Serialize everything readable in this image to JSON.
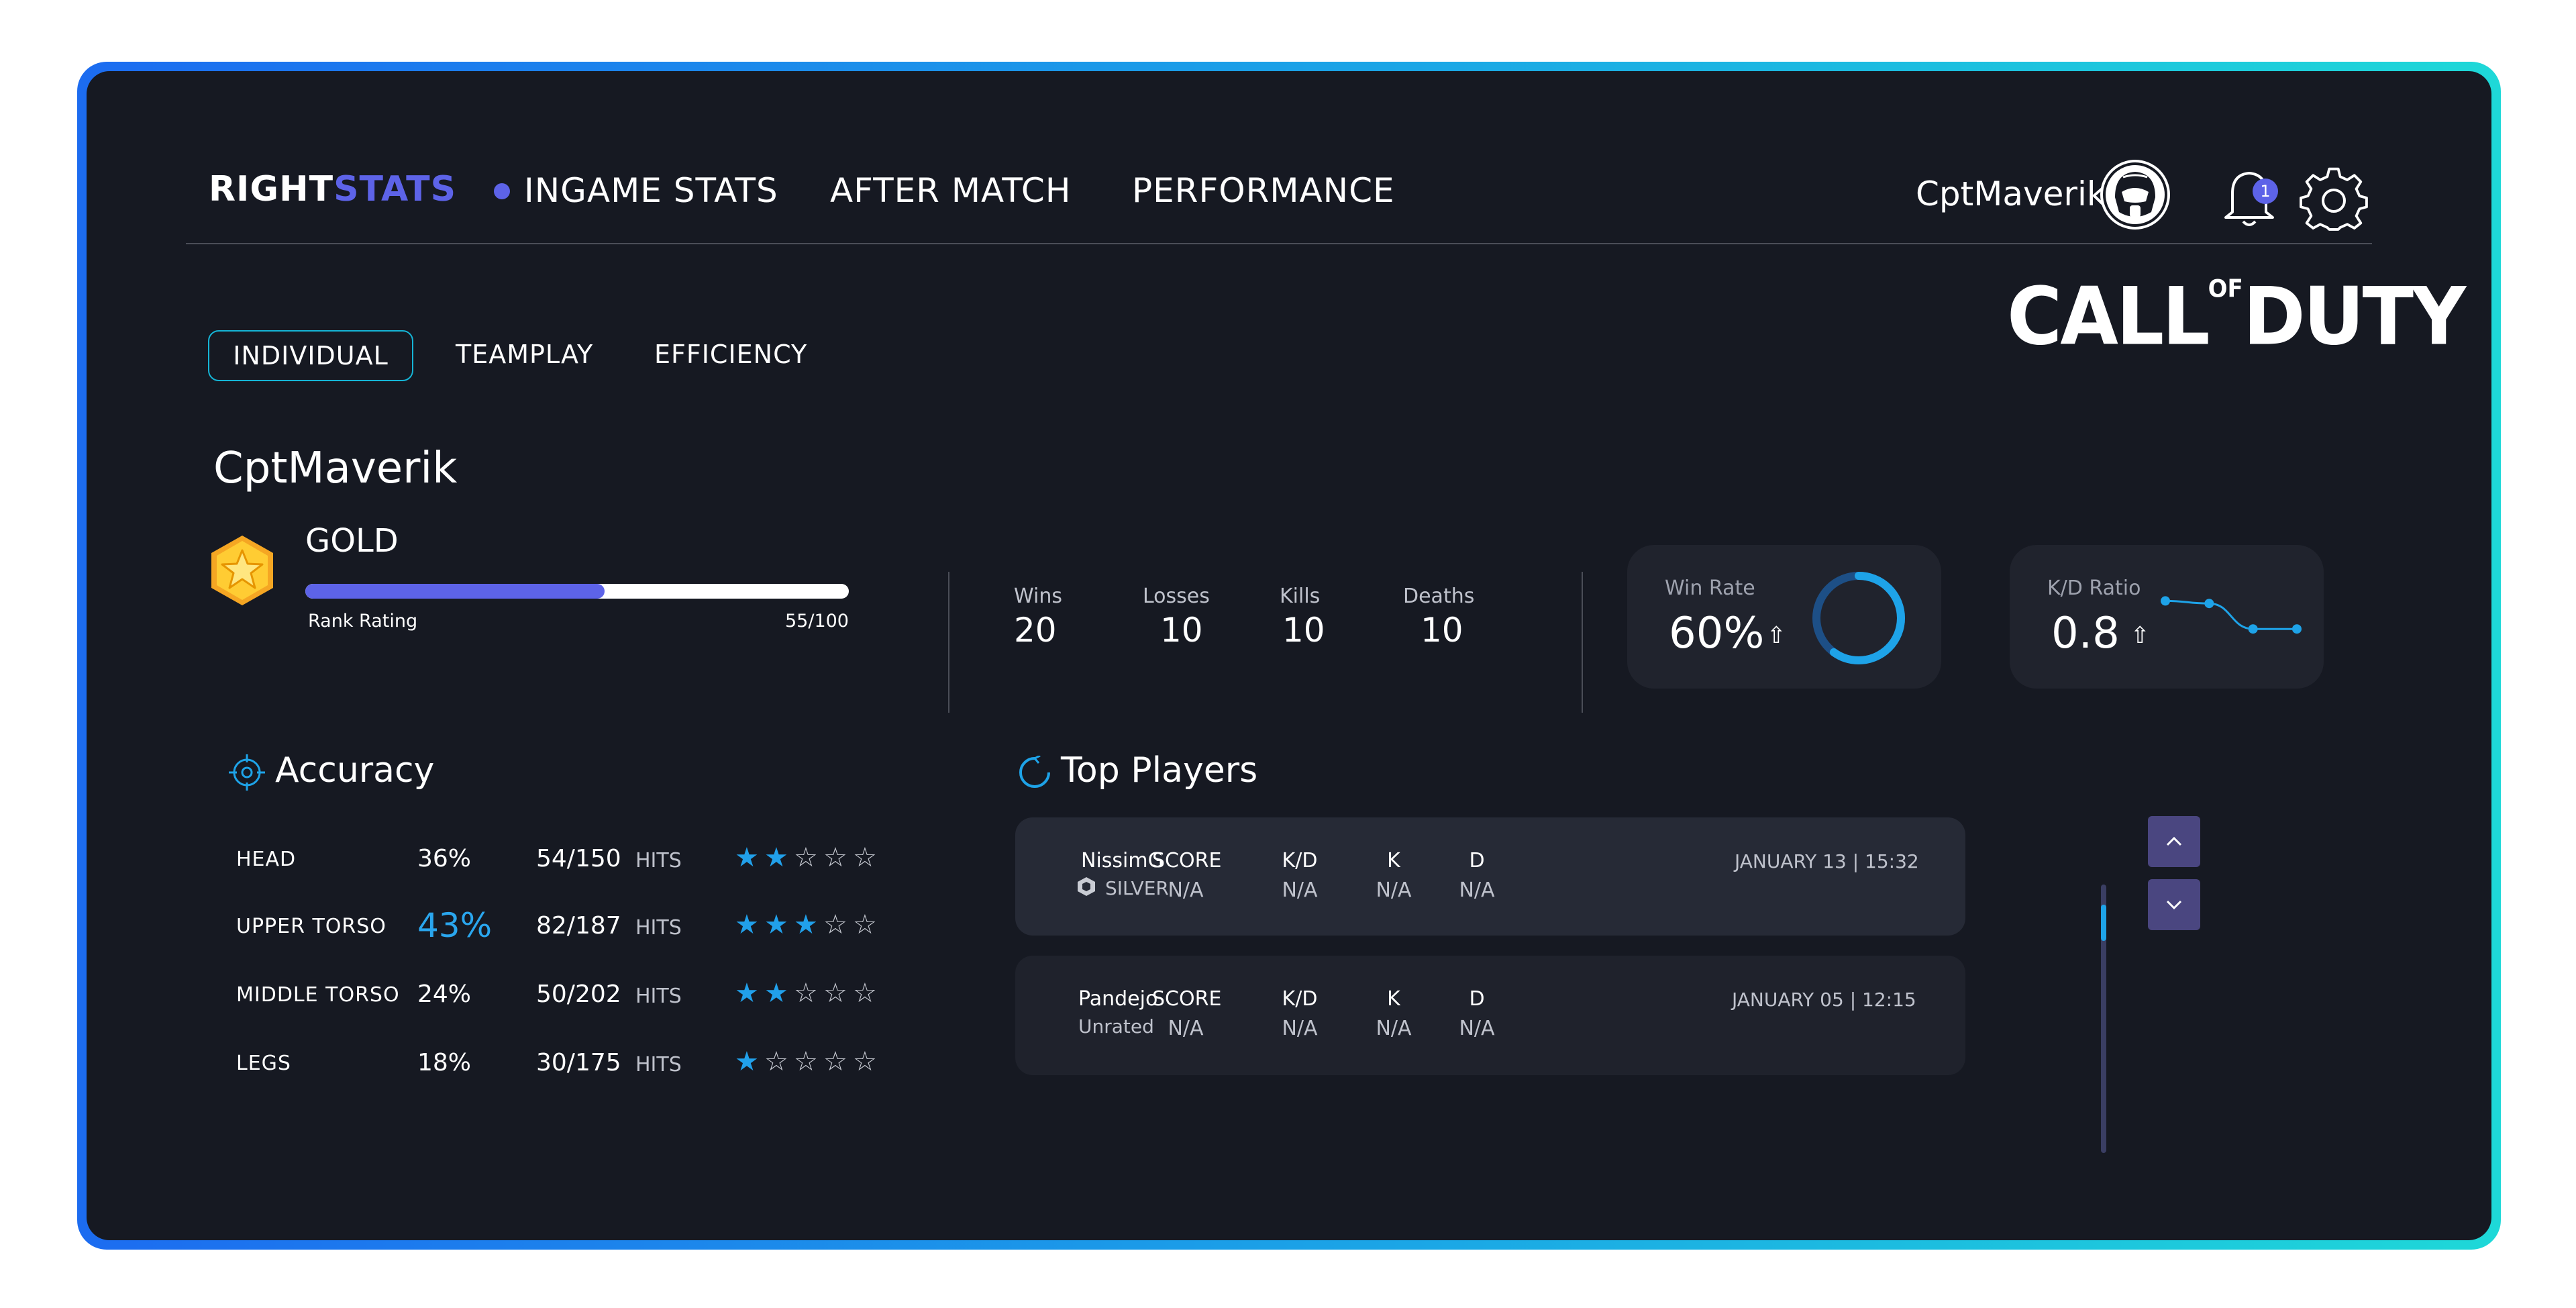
{
  "app": {
    "logo_prefix": "RIGHT",
    "logo_suffix": "STATS",
    "nav": [
      "INGAME STATS",
      "AFTER MATCH",
      "PERFORMANCE"
    ],
    "active_nav": "INGAME STATS",
    "username": "CptMaverik",
    "notification_count": "1"
  },
  "subtabs": [
    "INDIVIDUAL",
    "TEAMPLAY",
    "EFFICIENCY"
  ],
  "game_logo": {
    "main1": "CALL",
    "of": "OF",
    "main2": "DUTY"
  },
  "player": {
    "name": "CptMaverik",
    "rank": "GOLD",
    "rank_label": "Rank Rating",
    "rank_value": "55/100",
    "rank_progress": 0.55
  },
  "stats": [
    {
      "label": "Wins",
      "value": "20"
    },
    {
      "label": "Losses",
      "value": "10"
    },
    {
      "label": "Kills",
      "value": "10"
    },
    {
      "label": "Deaths",
      "value": "10"
    }
  ],
  "win_rate": {
    "label": "Win Rate",
    "value": "60%",
    "progress": 0.6
  },
  "kd_ratio": {
    "label": "K/D Ratio",
    "value": "0.8",
    "trend": [
      0.85,
      0.8,
      0.3,
      0.3
    ]
  },
  "accuracy": {
    "title": "Accuracy",
    "hits_label": "HITS",
    "rows": [
      {
        "part": "HEAD",
        "pct": "36%",
        "count": "54/150",
        "stars": 2,
        "highlight": false
      },
      {
        "part": "UPPER TORSO",
        "pct": "43%",
        "count": "82/187",
        "stars": 3,
        "highlight": true
      },
      {
        "part": "MIDDLE TORSO",
        "pct": "24%",
        "count": "50/202",
        "stars": 2,
        "highlight": false
      },
      {
        "part": "LEGS",
        "pct": "18%",
        "count": "30/175",
        "stars": 1,
        "highlight": false
      }
    ]
  },
  "top_players": {
    "title": "Top Players",
    "columns": [
      "SCORE",
      "K/D",
      "K",
      "D"
    ],
    "rows": [
      {
        "name": "NissimG",
        "tier": "SILVER",
        "values": [
          "N/A",
          "N/A",
          "N/A",
          "N/A"
        ],
        "date": "JANUARY 13 | 15:32"
      },
      {
        "name": "Pandejo",
        "tier": "Unrated",
        "values": [
          "N/A",
          "N/A",
          "N/A",
          "N/A"
        ],
        "date": "JANUARY 05 | 12:15"
      }
    ]
  },
  "colors": {
    "accent": "#5d63e8",
    "cyan": "#1ea3e8",
    "panel": "#161922",
    "card": "#20232d"
  }
}
